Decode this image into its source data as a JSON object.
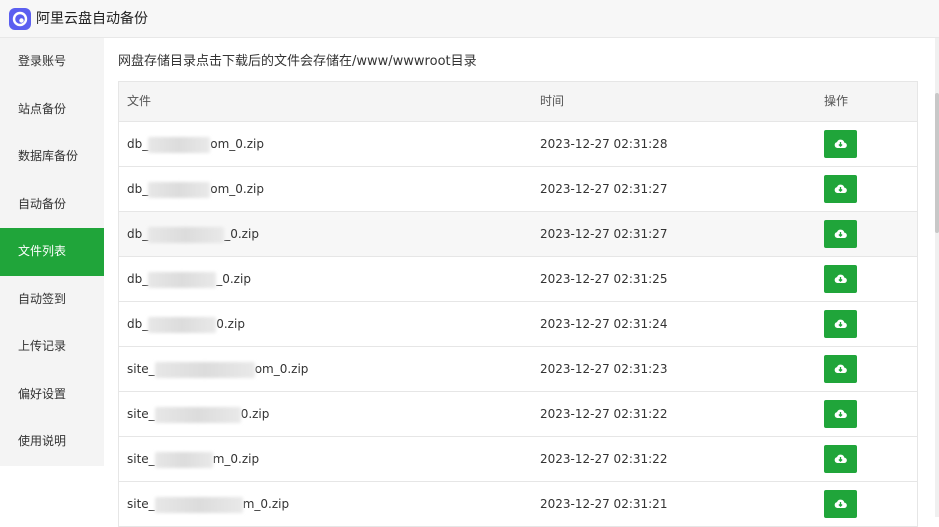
{
  "app": {
    "title": "阿里云盘自动备份",
    "icon": "aliyun-drive-logo"
  },
  "sidebar": {
    "items": [
      {
        "label": "登录账号"
      },
      {
        "label": "站点备份"
      },
      {
        "label": "数据库备份"
      },
      {
        "label": "自动备份"
      },
      {
        "label": "文件列表",
        "active": true
      },
      {
        "label": "自动签到"
      },
      {
        "label": "上传记录"
      },
      {
        "label": "偏好设置"
      },
      {
        "label": "使用说明"
      }
    ]
  },
  "main": {
    "description": "网盘存储目录点击下载后的文件会存储在/www/wwwroot目录",
    "table": {
      "headers": {
        "file": "文件",
        "time": "时间",
        "action": "操作"
      },
      "rows": [
        {
          "prefix": "db_",
          "suffix": "om_0.zip",
          "time": "2023-12-27 02:31:28"
        },
        {
          "prefix": "db_",
          "suffix": "om_0.zip",
          "time": "2023-12-27 02:31:27"
        },
        {
          "prefix": "db_",
          "suffix": "_0.zip",
          "time": "2023-12-27 02:31:27"
        },
        {
          "prefix": "db_",
          "suffix": "_0.zip",
          "time": "2023-12-27 02:31:25"
        },
        {
          "prefix": "db_",
          "suffix": "0.zip",
          "time": "2023-12-27 02:31:24"
        },
        {
          "prefix": "site_",
          "suffix": "om_0.zip",
          "time": "2023-12-27 02:31:23"
        },
        {
          "prefix": "site_",
          "suffix": "0.zip",
          "time": "2023-12-27 02:31:22"
        },
        {
          "prefix": "site_",
          "suffix": "m_0.zip",
          "time": "2023-12-27 02:31:22"
        },
        {
          "prefix": "site_",
          "suffix": "m_0.zip",
          "time": "2023-12-27 02:31:21"
        }
      ]
    }
  },
  "colors": {
    "accent": "#20a53a",
    "sidebar_bg": "#f4f4f4",
    "header_bg": "#f5f5f5"
  },
  "icons": {
    "download": "cloud-download-icon"
  }
}
